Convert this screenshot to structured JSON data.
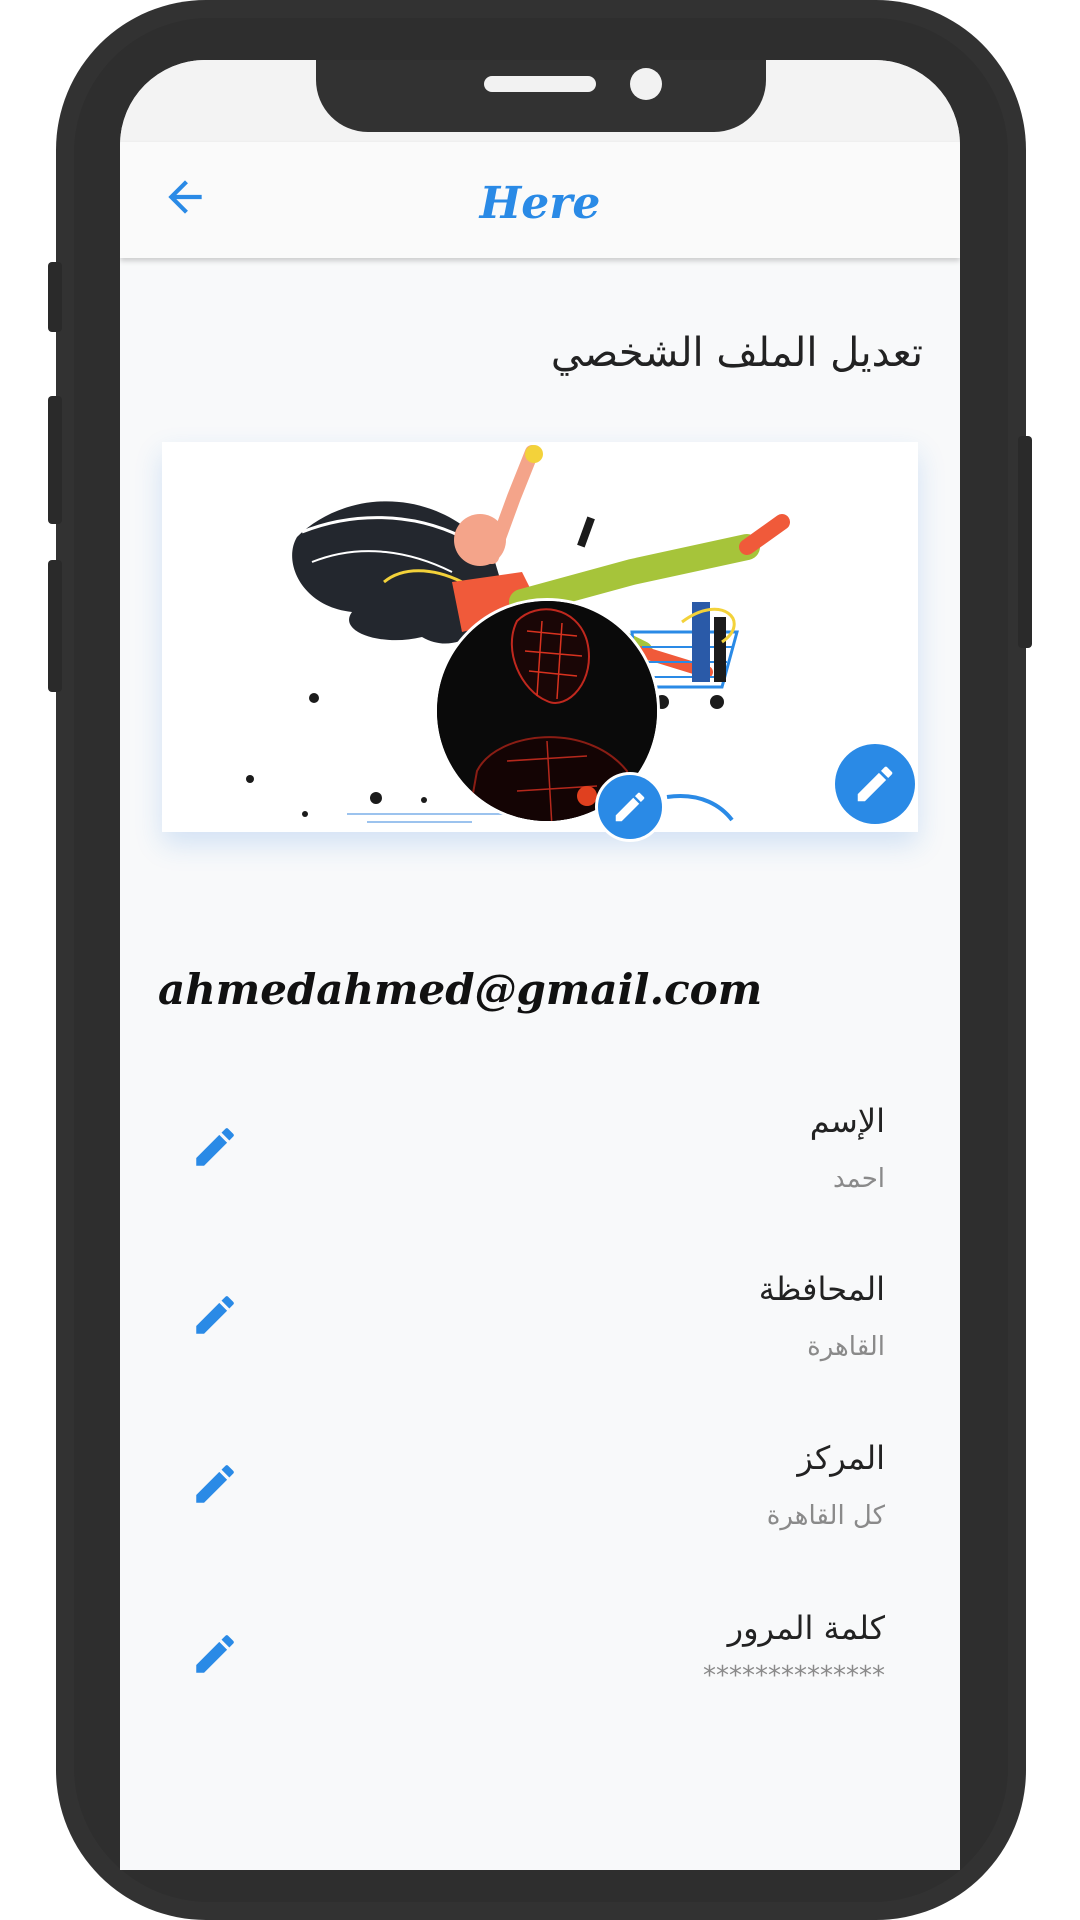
{
  "app": {
    "title": "Here",
    "accent_color": "#2a8ae6"
  },
  "header": {
    "back_icon": "arrow-back-icon"
  },
  "page": {
    "heading": "تعديل الملف الشخصي"
  },
  "profile": {
    "email": "ahmedahmed@gmail.com",
    "cover_edit_icon": "pencil-icon",
    "avatar_edit_icon": "pencil-icon"
  },
  "fields": [
    {
      "label": "الإسم",
      "value": "احمد",
      "edit_icon": "pencil-icon"
    },
    {
      "label": "المحافظة",
      "value": "القاهرة",
      "edit_icon": "pencil-icon"
    },
    {
      "label": "المركز",
      "value": "كل القاهرة",
      "edit_icon": "pencil-icon"
    },
    {
      "label": "كلمة المرور",
      "value": "**************",
      "edit_icon": "pencil-icon"
    }
  ]
}
